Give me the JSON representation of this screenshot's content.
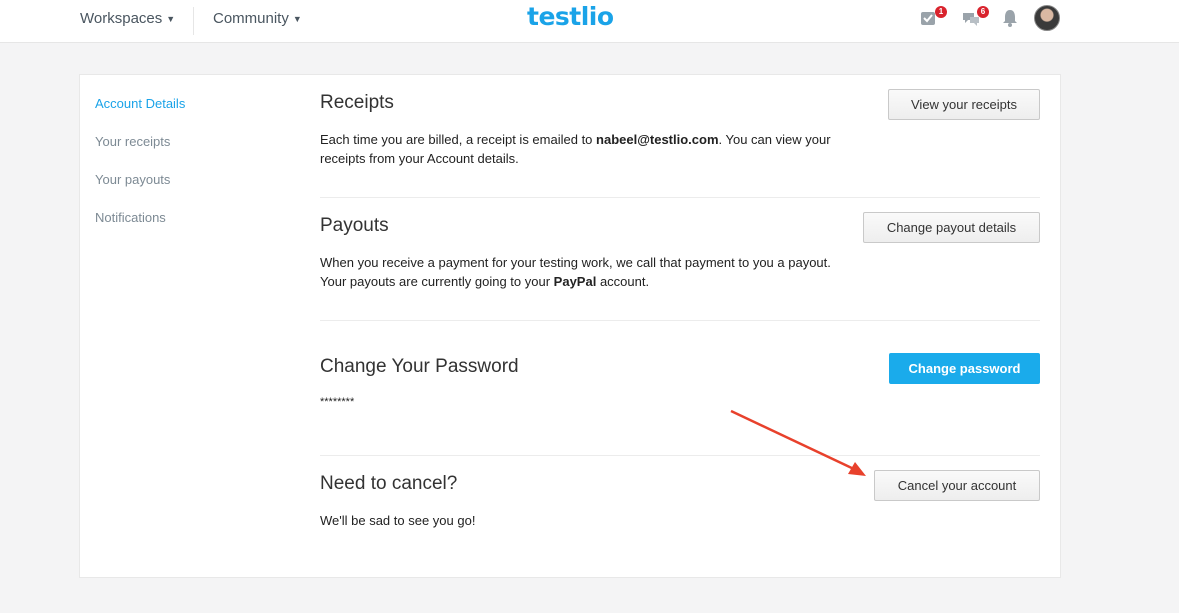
{
  "header": {
    "nav": [
      {
        "label": "Workspaces"
      },
      {
        "label": "Community"
      }
    ],
    "logo": "testlio",
    "tasks_badge": "1",
    "messages_badge": "6"
  },
  "sidebar": {
    "items": [
      {
        "label": "Account Details"
      },
      {
        "label": "Your receipts"
      },
      {
        "label": "Your payouts"
      },
      {
        "label": "Notifications"
      }
    ]
  },
  "receipts": {
    "title": "Receipts",
    "text_before": "Each time you are billed, a receipt is emailed to ",
    "email": "nabeel@testlio.com",
    "text_after": ". You can view your receipts from your Account details.",
    "button": "View your receipts"
  },
  "payouts": {
    "title": "Payouts",
    "text_line1": "When you receive a payment for your testing work, we call that payment to you a payout.",
    "text_before": "Your payouts are currently going to your ",
    "provider": "PayPal",
    "text_after": " account.",
    "button": "Change payout details"
  },
  "password": {
    "title": "Change Your Password",
    "masked": "********",
    "button": "Change password"
  },
  "cancel": {
    "title": "Need to cancel?",
    "text": "We'll be sad to see you go!",
    "button": "Cancel your account"
  },
  "colors": {
    "accent": "#1aa3e8",
    "primary_button": "#1aabeb",
    "badge": "#d9232d",
    "annotation_arrow": "#e8412c"
  }
}
